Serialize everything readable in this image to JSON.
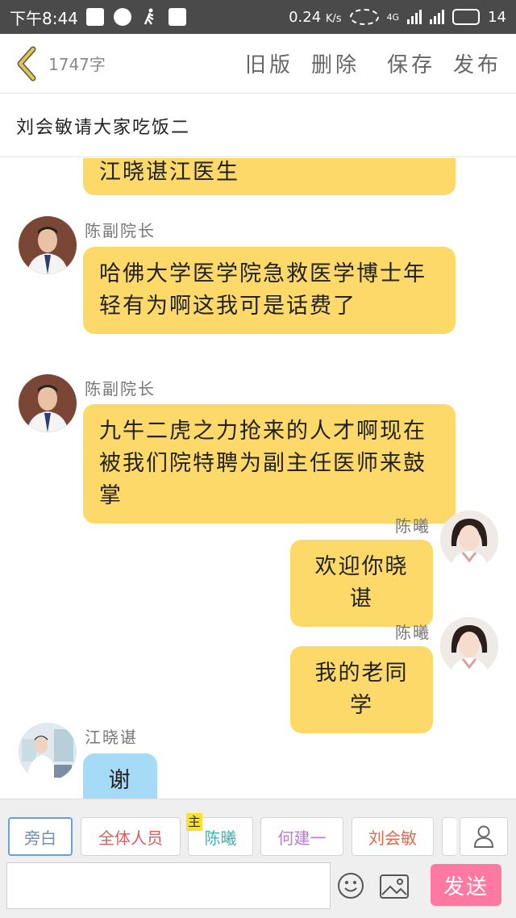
{
  "status_bar": {
    "time": "下午8:44",
    "speed": "0.24",
    "speed_unit": "K/s",
    "network": "4G",
    "battery": "14"
  },
  "header": {
    "word_count": "1747字",
    "actions": [
      "旧版",
      "删除",
      "保存",
      "发布"
    ]
  },
  "title": "刘会敏请大家吃饭二",
  "messages": [
    {
      "speaker": "",
      "text": "江晓谌江医生",
      "side": "left"
    },
    {
      "speaker": "陈副院长",
      "text": "哈佛大学医学院急救医学博士年轻有为啊这我可是话费了",
      "side": "left"
    },
    {
      "speaker": "陈副院长",
      "text": "九牛二虎之力抢来的人才啊现在被我们院特聘为副主任医师来鼓掌",
      "side": "left"
    },
    {
      "speaker": "陈曦",
      "text": "欢迎你晓谌",
      "side": "right"
    },
    {
      "speaker": "陈曦",
      "text": "我的老同学",
      "side": "right"
    },
    {
      "speaker": "江晓谌",
      "text": "谢谢",
      "side": "left"
    }
  ],
  "roles": [
    {
      "label": "旁白",
      "color": "#6e8fb8",
      "tag": ""
    },
    {
      "label": "全体人员",
      "color": "#e05c5c",
      "tag": ""
    },
    {
      "label": "陈曦",
      "color": "#3bb3b3",
      "tag": "主"
    },
    {
      "label": "何建一",
      "color": "#b87ad9",
      "tag": ""
    },
    {
      "label": "刘会敏",
      "color": "#e26a4a",
      "tag": ""
    }
  ],
  "composer": {
    "placeholder": "",
    "send_label": "发送"
  },
  "icons": {
    "back": "chevron-left-icon",
    "person": "person-icon",
    "emoji": "smiley-icon",
    "image": "image-icon"
  },
  "colors": {
    "bubble_yellow": "#fdd96a",
    "bubble_blue": "#a6dbf7",
    "send": "#ff79a3",
    "back_arrow": "#e3c54a"
  }
}
